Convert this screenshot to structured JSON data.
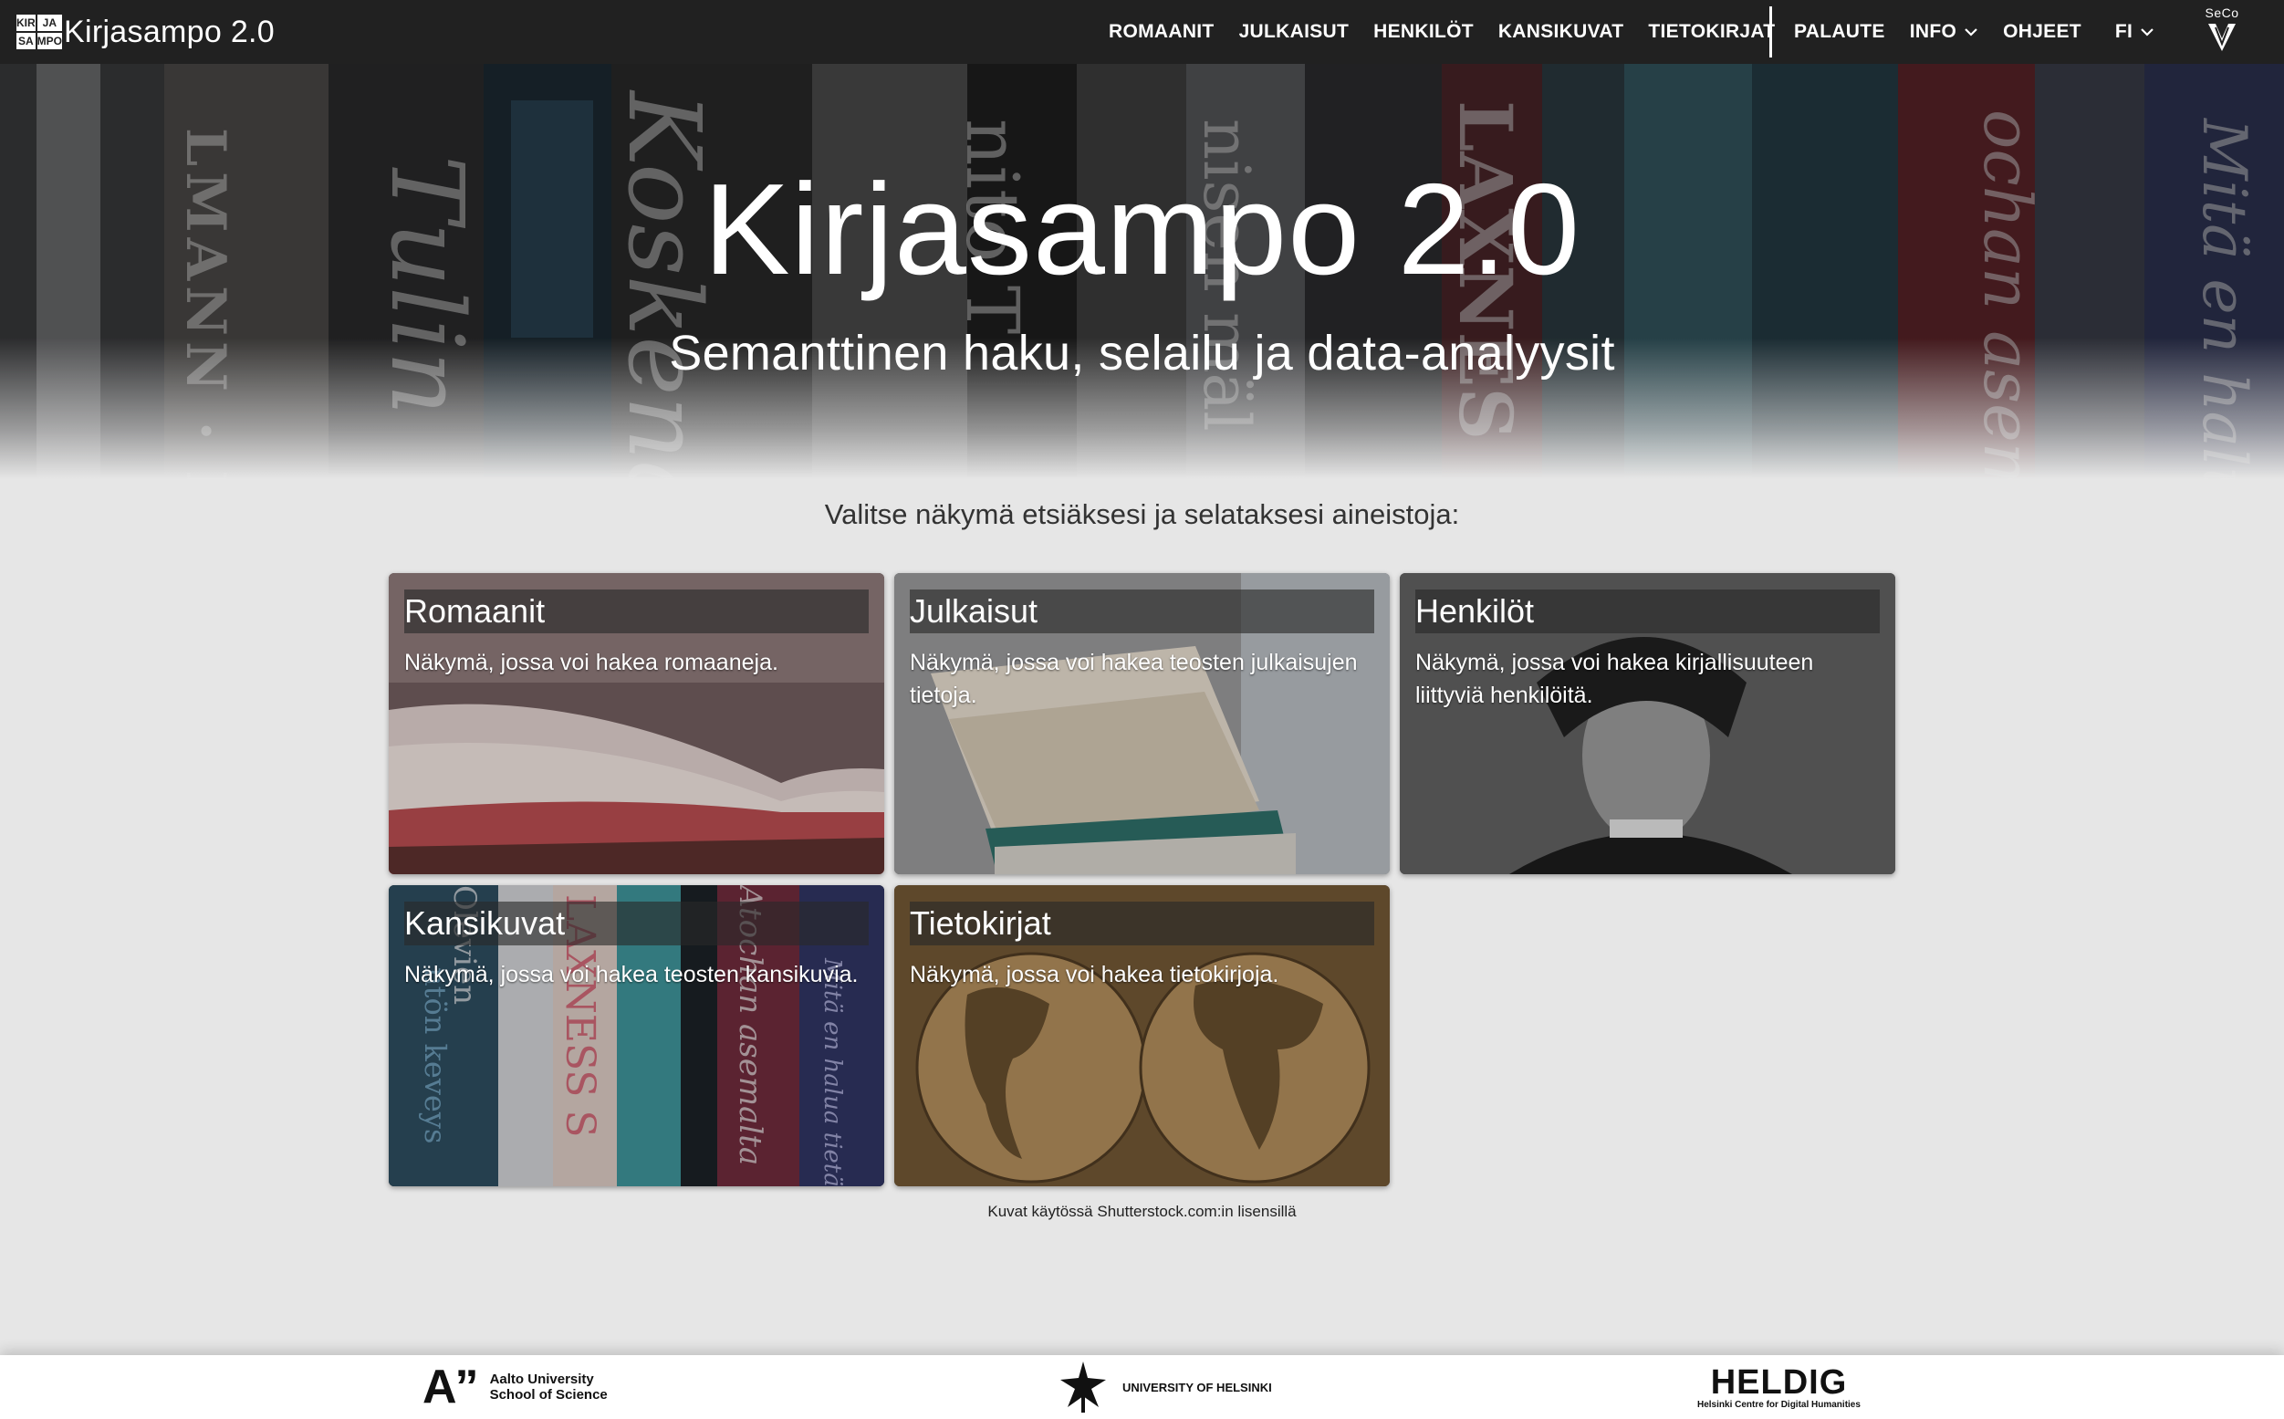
{
  "app": {
    "title": "Kirjasampo 2.0",
    "logo_letters": [
      "KIR",
      "JA",
      "SA",
      "MPO"
    ]
  },
  "nav": {
    "left": [
      "ROMAANIT",
      "JULKAISUT",
      "HENKILÖT",
      "KANSIKUVAT",
      "TIETOKIRJAT"
    ],
    "feedback": "PALAUTE",
    "info": "INFO",
    "help": "OHJEET",
    "language": "FI",
    "seco_label": "SeCo"
  },
  "hero": {
    "title": "Kirjasampo 2.0",
    "subtitle": "Semanttinen haku, selailu ja data-analyysit",
    "spine_texts": [
      "LMANN · MA",
      "Tulin",
      "Koskena",
      "nito T",
      "nisen mäl",
      "LAXNES",
      "ochan asema",
      "Mitä en halu"
    ]
  },
  "main": {
    "prompt": "Valitse näkymä etsiäksesi ja selataksesi aineistoja:",
    "cards": [
      {
        "title": "Romaanit",
        "description": "Näkymä, jossa voi hakea romaaneja."
      },
      {
        "title": "Julkaisut",
        "description": "Näkymä, jossa voi hakea teosten julkaisujen tietoja."
      },
      {
        "title": "Henkilöt",
        "description": "Näkymä, jossa voi hakea kirjallisuuteen liittyviä henkilöitä."
      },
      {
        "title": "Kansikuvat",
        "description": "Näkymä, jossa voi hakea teosten kansikuvia."
      },
      {
        "title": "Tietokirjat",
        "description": "Näkymä, jossa voi hakea tietokirjoja."
      }
    ],
    "kansikuvat_spines": [
      "Olevien",
      "ntön keveys",
      "LAXNESS S",
      "Atochan asemalta",
      "Mitä en halua tietää"
    ],
    "credit": "Kuvat käytössä Shutterstock.com:in lisensillä"
  },
  "footer": {
    "aalto_mark": "A”",
    "aalto_line1": "Aalto University",
    "aalto_line2": "School of Science",
    "uh_label": "UNIVERSITY OF HELSINKI",
    "heldig_mark": "HELDIG",
    "heldig_sub": "Helsinki Centre for Digital Humanities"
  },
  "colors": {
    "topbar": "#212121",
    "background": "#e6e6e6",
    "text_dark": "#333333"
  }
}
